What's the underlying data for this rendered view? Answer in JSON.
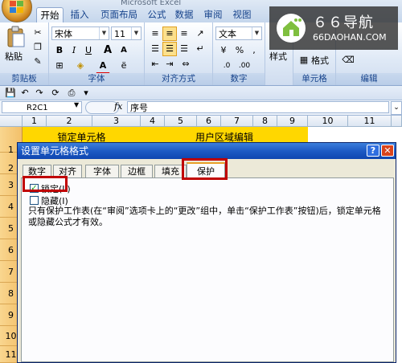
{
  "window": {
    "title": "Microsoft Excel"
  },
  "tabs": [
    "开始",
    "插入",
    "页面布局",
    "公式",
    "数据",
    "审阅",
    "视图"
  ],
  "ribbon": {
    "font_name": "宋体",
    "font_size": "11",
    "number_format": "文本",
    "paste_label": "粘贴",
    "bold": "B",
    "italic": "I",
    "underline": "U",
    "grow_font": "A",
    "shrink_font": "A",
    "font_color": "A",
    "percent": "%",
    "comma": ",",
    "style_label": "样式",
    "format_label": "格式",
    "groups": [
      "剪贴板",
      "字体",
      "对齐方式",
      "数字",
      "单元格",
      "编辑"
    ]
  },
  "formula_bar": {
    "name_box": "R2C1",
    "fx": "fx",
    "content": "序号"
  },
  "sheet": {
    "columns": [
      "1",
      "2",
      "3",
      "4",
      "5",
      "6",
      "7",
      "8",
      "9",
      "10",
      "11"
    ],
    "rows": [
      "1",
      "2",
      "3",
      "4",
      "5",
      "6",
      "7",
      "8",
      "9",
      "10",
      "11"
    ],
    "header_left": "锁定单元格",
    "header_right": "用户区域编辑"
  },
  "dialog": {
    "title": "设置单元格格式",
    "help": "?",
    "close": "✕",
    "tabs": [
      "数字",
      "对齐",
      "字体",
      "边框",
      "填充",
      "保护"
    ],
    "active_tab": "保护",
    "locked_label": "锁定(L)",
    "hidden_label": "隐藏(I)",
    "locked_checked": "✓",
    "note": "只有保护工作表(在“审阅”选项卡上的“更改”组中，单击“保护工作表”按钮)后，锁定单元格或隐藏公式才有效。"
  },
  "watermark": {
    "title": "６６导航",
    "url": "66DAOHAN.COM"
  },
  "colors": {
    "ribbon_text": "#15428b",
    "highlight": "#ffd700",
    "row_header": "#f3c06a",
    "callout": "#c00000",
    "dialog_title": "#1d5ac4"
  }
}
